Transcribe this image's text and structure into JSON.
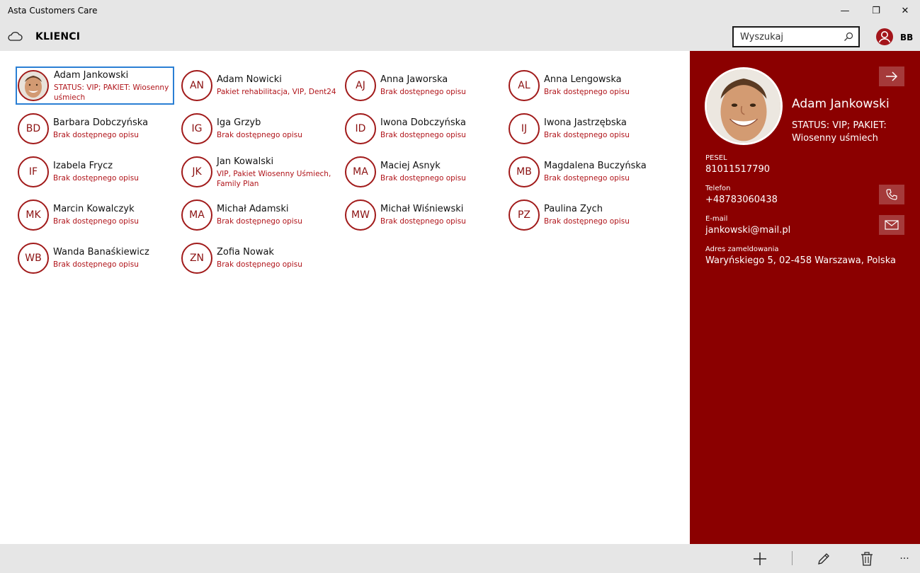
{
  "window": {
    "title": "Asta Customers Care",
    "minimize_glyph": "—",
    "maximize_glyph": "❐",
    "close_glyph": "✕"
  },
  "header": {
    "title": "KLIENCI",
    "search_placeholder": "Wyszukaj",
    "user_initials": "BB",
    "icons": [
      "cloud-icon",
      "search-icon",
      "user-icon"
    ]
  },
  "colors": {
    "accent": "#8b0000",
    "accent_text": "#b0141a",
    "selection": "#2a7fd4"
  },
  "clients": [
    {
      "initials": "",
      "name": "Adam Jankowski",
      "desc": "STATUS: VIP; PAKIET: Wiosenny uśmiech",
      "photo": true,
      "selected": true
    },
    {
      "initials": "AN",
      "name": "Adam Nowicki",
      "desc": "Pakiet rehabilitacja, VIP, Dent24"
    },
    {
      "initials": "AJ",
      "name": "Anna Jaworska",
      "desc": "Brak dostępnego opisu"
    },
    {
      "initials": "AL",
      "name": "Anna Lengowska",
      "desc": "Brak dostępnego opisu"
    },
    {
      "initials": "BD",
      "name": "Barbara Dobczyńska",
      "desc": "Brak dostępnego opisu"
    },
    {
      "initials": "IG",
      "name": "Iga Grzyb",
      "desc": "Brak dostępnego opisu"
    },
    {
      "initials": "ID",
      "name": "Iwona Dobczyńska",
      "desc": "Brak dostępnego opisu"
    },
    {
      "initials": "IJ",
      "name": "Iwona Jastrzębska",
      "desc": "Brak dostępnego opisu"
    },
    {
      "initials": "IF",
      "name": "Izabela Frycz",
      "desc": "Brak dostępnego opisu"
    },
    {
      "initials": "JK",
      "name": "Jan Kowalski",
      "desc": "VIP, Pakiet Wiosenny Uśmiech, Family Plan"
    },
    {
      "initials": "MA",
      "name": "Maciej Asnyk",
      "desc": "Brak dostępnego opisu"
    },
    {
      "initials": "MB",
      "name": "Magdalena Buczyńska",
      "desc": "Brak dostępnego opisu"
    },
    {
      "initials": "MK",
      "name": "Marcin Kowalczyk",
      "desc": "Brak dostępnego opisu"
    },
    {
      "initials": "MA",
      "name": "Michał Adamski",
      "desc": "Brak dostępnego opisu"
    },
    {
      "initials": "MW",
      "name": "Michał Wiśniewski",
      "desc": "Brak dostępnego opisu"
    },
    {
      "initials": "PZ",
      "name": "Paulina Zych",
      "desc": "Brak dostępnego opisu"
    },
    {
      "initials": "WB",
      "name": "Wanda Banaśkiewicz",
      "desc": "Brak dostępnego opisu"
    },
    {
      "initials": "ZN",
      "name": "Zofia Nowak",
      "desc": "Brak dostępnego opisu"
    }
  ],
  "detail": {
    "name": "Adam Jankowski",
    "desc": "STATUS: VIP; PAKIET: Wiosenny uśmiech",
    "pesel_label": "PESEL",
    "pesel": "81011517790",
    "phone_label": "Telefon",
    "phone": "+48783060438",
    "email_label": "E-mail",
    "email": "jankowski@mail.pl",
    "address_label": "Adres zameldowania",
    "address": "Waryńskiego 5, 02-458 Warszawa, Polska",
    "icons": [
      "arrow-right-icon",
      "phone-icon",
      "mail-icon"
    ]
  },
  "commands": {
    "icons": [
      "add-icon",
      "edit-icon",
      "delete-icon",
      "more-icon"
    ],
    "more_glyph": "···"
  }
}
